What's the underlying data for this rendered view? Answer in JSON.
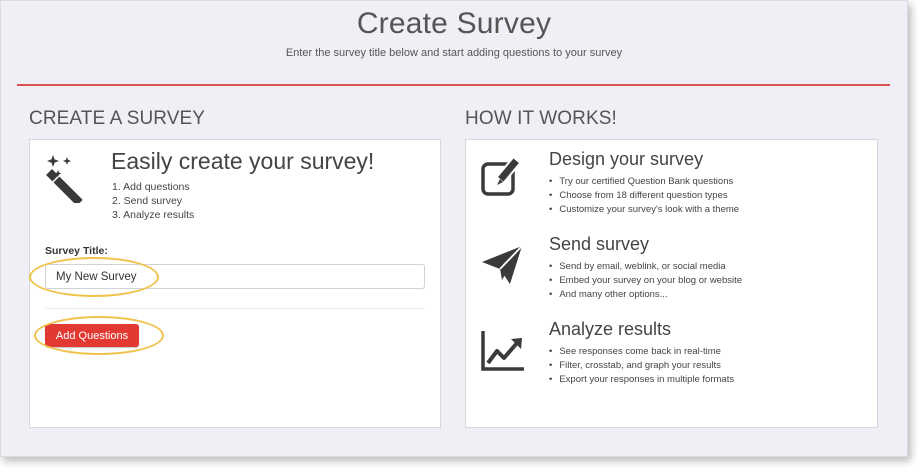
{
  "header": {
    "title": "Create Survey",
    "subtitle": "Enter the survey title below and start adding questions to your survey"
  },
  "create_section": {
    "heading": "CREATE A SURVEY",
    "icon": "magic-wand-icon",
    "title": "Easily create your survey!",
    "steps": [
      "1. Add questions",
      "2. Send survey",
      "3. Analyze results"
    ],
    "field_label": "Survey Title:",
    "field_value": "My New Survey",
    "button_label": "Add Questions"
  },
  "how_section": {
    "heading": "HOW IT WORKS!",
    "items": [
      {
        "icon": "edit-icon",
        "title": "Design your survey",
        "bullets": [
          "Try our certified Question Bank questions",
          "Choose from 18 different question types",
          "Customize your survey's look with a theme"
        ]
      },
      {
        "icon": "send-icon",
        "title": "Send survey",
        "bullets": [
          "Send by email, weblink, or social media",
          "Embed your survey on your blog or website",
          "And many other options..."
        ]
      },
      {
        "icon": "chart-icon",
        "title": "Analyze results",
        "bullets": [
          "See responses come back in real-time",
          "Filter, crosstab, and graph your results",
          "Export your responses in multiple formats"
        ]
      }
    ]
  },
  "colors": {
    "accent": "#e23a33",
    "divider": "#d9534f",
    "highlight": "#f0c24b",
    "background": "#eef0f5"
  }
}
